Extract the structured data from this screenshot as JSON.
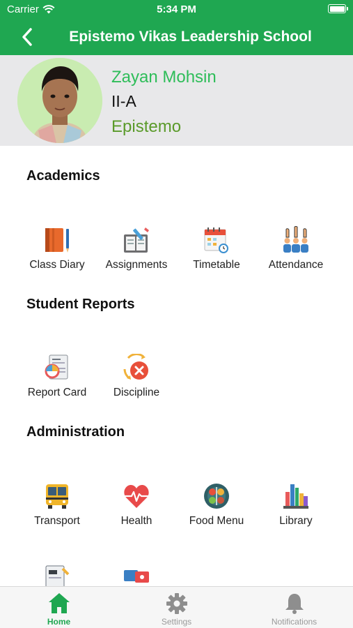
{
  "status_bar": {
    "carrier": "Carrier",
    "time": "5:34 PM"
  },
  "nav": {
    "title": "Epistemo Vikas Leadership School",
    "back_icon": "chevron-left-icon"
  },
  "student": {
    "name": "Zayan Mohsin",
    "class": "II-A",
    "school": "Epistemo"
  },
  "sections": {
    "academics": {
      "title": "Academics",
      "items": [
        {
          "label": "Class Diary",
          "icon": "diary-icon"
        },
        {
          "label": "Assignments",
          "icon": "assignments-icon"
        },
        {
          "label": "Timetable",
          "icon": "calendar-clock-icon"
        },
        {
          "label": "Attendance",
          "icon": "raised-hands-icon"
        }
      ]
    },
    "reports": {
      "title": "Student Reports",
      "items": [
        {
          "label": "Report Card",
          "icon": "report-card-icon"
        },
        {
          "label": "Discipline",
          "icon": "discipline-icon"
        }
      ]
    },
    "administration": {
      "title": "Administration",
      "items": [
        {
          "label": "Transport",
          "icon": "bus-icon"
        },
        {
          "label": "Health",
          "icon": "heartbeat-icon"
        },
        {
          "label": "Food Menu",
          "icon": "food-plate-icon"
        },
        {
          "label": "Library",
          "icon": "books-icon"
        }
      ]
    }
  },
  "tabs": [
    {
      "label": "Home",
      "icon": "home-icon",
      "active": true
    },
    {
      "label": "Settings",
      "icon": "gear-icon",
      "active": false
    },
    {
      "label": "Notifications",
      "icon": "bell-icon",
      "active": false
    }
  ],
  "colors": {
    "brand_green": "#1fa751",
    "name_green": "#2ebd59",
    "school_green": "#5a9a2a",
    "profile_bg": "#e8e8ea"
  }
}
